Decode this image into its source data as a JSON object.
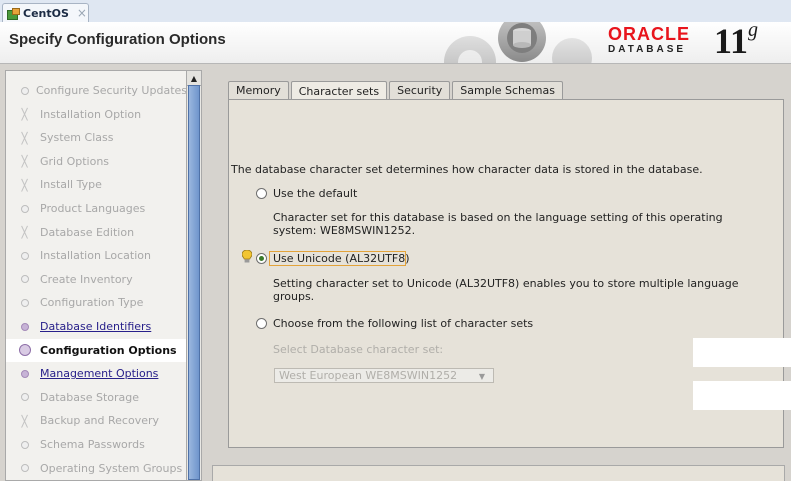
{
  "window": {
    "tab_title": "CentOS",
    "close_glyph": "×"
  },
  "header": {
    "page_title": "Specify Configuration Options",
    "brand": {
      "oracle": "ORACLE",
      "database": "DATABASE",
      "version": "11",
      "version_suffix": "g"
    }
  },
  "sidebar": {
    "items": [
      {
        "label": "Configure Security Updates",
        "state": "done",
        "glyph": "dot"
      },
      {
        "label": "Installation Option",
        "state": "done",
        "glyph": "cross"
      },
      {
        "label": "System Class",
        "state": "done",
        "glyph": "cross"
      },
      {
        "label": "Grid Options",
        "state": "done",
        "glyph": "cross"
      },
      {
        "label": "Install Type",
        "state": "done",
        "glyph": "cross"
      },
      {
        "label": "Product Languages",
        "state": "done",
        "glyph": "dot"
      },
      {
        "label": "Database Edition",
        "state": "done",
        "glyph": "cross"
      },
      {
        "label": "Installation Location",
        "state": "done",
        "glyph": "dot"
      },
      {
        "label": "Create Inventory",
        "state": "done",
        "glyph": "dot"
      },
      {
        "label": "Configuration Type",
        "state": "done",
        "glyph": "dot"
      },
      {
        "label": "Database Identifiers",
        "state": "link",
        "glyph": "dot"
      },
      {
        "label": "Configuration Options",
        "state": "current",
        "glyph": "dot"
      },
      {
        "label": "Management Options",
        "state": "link",
        "glyph": "dot"
      },
      {
        "label": "Database Storage",
        "state": "pending",
        "glyph": "dot"
      },
      {
        "label": "Backup and Recovery",
        "state": "pending",
        "glyph": "cross"
      },
      {
        "label": "Schema Passwords",
        "state": "pending",
        "glyph": "dot"
      },
      {
        "label": "Operating System Groups",
        "state": "pending",
        "glyph": "dot"
      }
    ],
    "scroll_up_glyph": "▲"
  },
  "tabs": [
    {
      "label": "Memory",
      "active": false
    },
    {
      "label": "Character sets",
      "active": true
    },
    {
      "label": "Security",
      "active": false
    },
    {
      "label": "Sample Schemas",
      "active": false
    }
  ],
  "charset": {
    "intro": "The database character set determines how character data is stored in the database.",
    "option_default": {
      "label": "Use the default",
      "selected": false,
      "desc_line1": "Character set for this database is based on the language setting of this operating",
      "desc_line2": "system: WE8MSWIN1252."
    },
    "option_unicode": {
      "label": "Use Unicode (AL32UTF8)",
      "selected": true,
      "desc_line1": "Setting character set to Unicode (AL32UTF8) enables you to store multiple language",
      "desc_line2": "groups."
    },
    "option_list": {
      "label": "Choose from the following list of character sets",
      "selected": false,
      "select_label": "Select Database character set:",
      "select_value": "West European WE8MSWIN1252",
      "arrow_glyph": "▼"
    }
  },
  "colors": {
    "oracle_red": "#e8141c",
    "link_purple": "#28208a",
    "selected_green": "#3a7a2a",
    "focus_orange": "#e3a33a"
  }
}
